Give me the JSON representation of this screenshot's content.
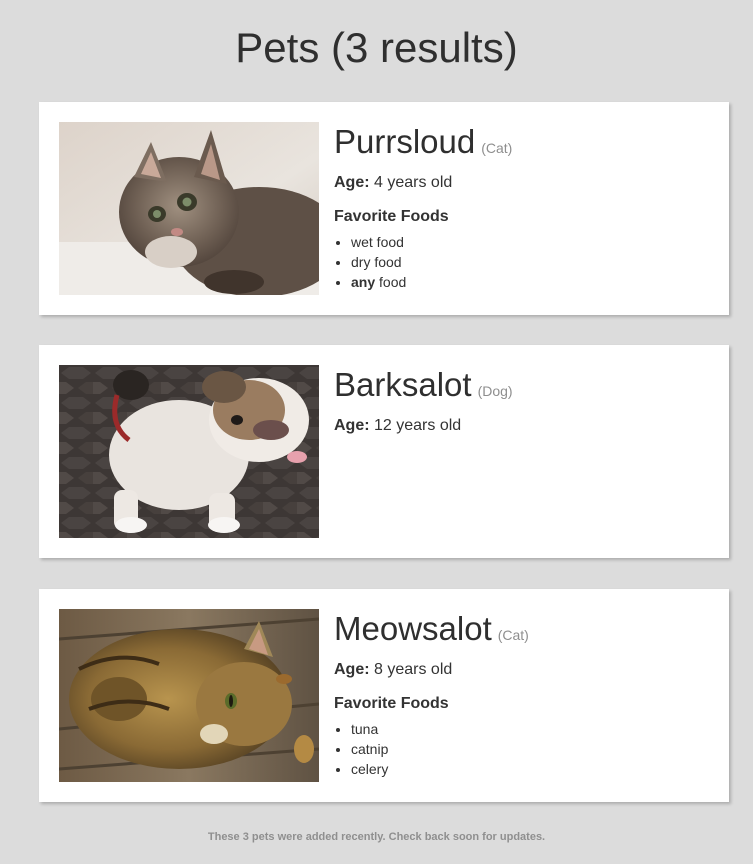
{
  "page": {
    "title": "Pets (3 results)",
    "footer": "These 3 pets were added recently. Check back soon for updates."
  },
  "pets": [
    {
      "name": "Purrsloud",
      "species": "(Cat)",
      "age_label": "Age:",
      "age_value": "4 years old",
      "foods_heading": "Favorite Foods",
      "foods": [
        "wet food",
        "dry food"
      ],
      "food_emphasis": "any",
      "food_emphasis_rest": " food",
      "photo": "kitten-photo"
    },
    {
      "name": "Barksalot",
      "species": "(Dog)",
      "age_label": "Age:",
      "age_value": "12 years old",
      "photo": "bulldog-photo"
    },
    {
      "name": "Meowsalot",
      "species": "(Cat)",
      "age_label": "Age:",
      "age_value": "8 years old",
      "foods_heading": "Favorite Foods",
      "foods": [
        "tuna",
        "catnip",
        "celery"
      ],
      "photo": "tabby-cat-photo"
    }
  ],
  "colors": {
    "background": "#dcdcdc",
    "card": "#ffffff",
    "text": "#2f2f2f",
    "muted": "#8e8e8e"
  }
}
